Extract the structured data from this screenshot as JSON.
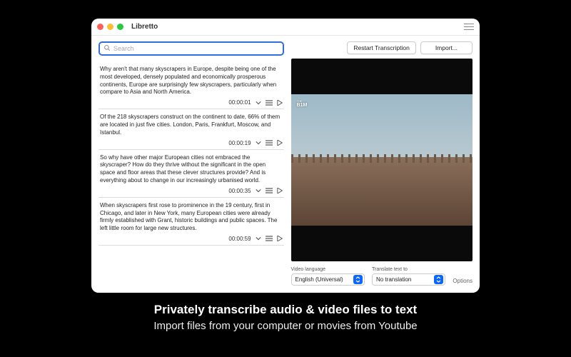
{
  "window": {
    "title": "Libretto"
  },
  "search": {
    "placeholder": "Search"
  },
  "segments": [
    {
      "text": "Why aren't that many skyscrapers in Europe, despite being one of the most developed, densely populated and economically prosperous continents, Europe are surprisingly few skyscrapers, particularly when compare to Asia and North America.",
      "time": "00:00:01"
    },
    {
      "text": "Of the 218 skyscrapers construct on the continent to date, 66% of them are located in just five cities. London, Paris, Frankfurt, Moscow, and Istanbul.",
      "time": "00:00:19"
    },
    {
      "text": "So why have other major European cities not embraced the skyscraper? How do they thrive without the significant in the open space and floor areas that these clever structures provide? And is everything about to change in our increasingly urbanised world.",
      "time": "00:00:35"
    },
    {
      "text": "When skyscrapers first rose to prominence in the 19 century, first in Chicago, and later in New York, many European cities were already firmly established with Grant, historic buildings and public spaces. The left little room for large new structures.",
      "time": "00:00:59"
    }
  ],
  "toolbar": {
    "restart": "Restart Transcription",
    "import": "Import..."
  },
  "video": {
    "watermark_small": "THE",
    "watermark": "B1M"
  },
  "fields": {
    "video_language_label": "Video language",
    "video_language_value": "English (Universal)",
    "translate_label": "Translate text to",
    "translate_value": "No translation",
    "options": "Options"
  },
  "tagline": {
    "line1": "Privately transcribe audio & video files to text",
    "line2": "Import files from your computer or movies from Youtube"
  }
}
